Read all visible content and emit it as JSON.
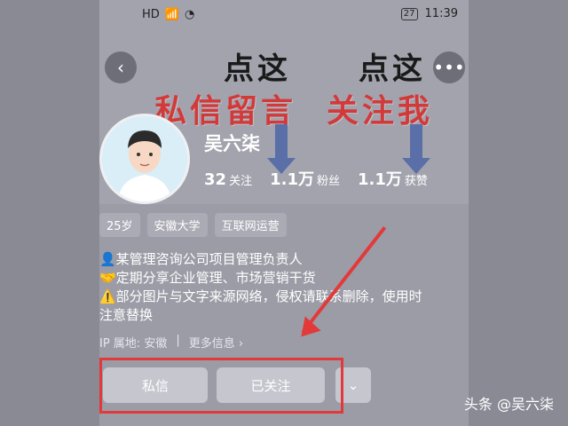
{
  "status": {
    "time": "11:39",
    "battery": "27",
    "network": "HD"
  },
  "banner": {
    "line1_left": "点这",
    "line1_right": "点这",
    "line2_left": "私信留言",
    "line2_right": "关注我"
  },
  "profile": {
    "name": "吴六柒",
    "following_count": "32",
    "following_label": "关注",
    "fans_count": "1.1万",
    "fans_label": "粉丝",
    "likes_count": "1.1万",
    "likes_label": "获赞",
    "tags": [
      "25岁",
      "安徽大学",
      "互联网运营"
    ],
    "bio": [
      "👤某管理咨询公司项目管理负责人",
      "🤝定期分享企业管理、市场营销干货",
      "⚠️部分图片与文字来源网络，侵权请联系删除，使用时",
      "注意替换"
    ],
    "ip_label": "IP 属地: 安徽",
    "more_info": "更多信息 ›"
  },
  "buttons": {
    "message": "私信",
    "followed": "已关注",
    "dropdown": "⌄"
  },
  "watermark": "头条 @吴六柒",
  "colors": {
    "accent_red": "#e23a3a"
  }
}
